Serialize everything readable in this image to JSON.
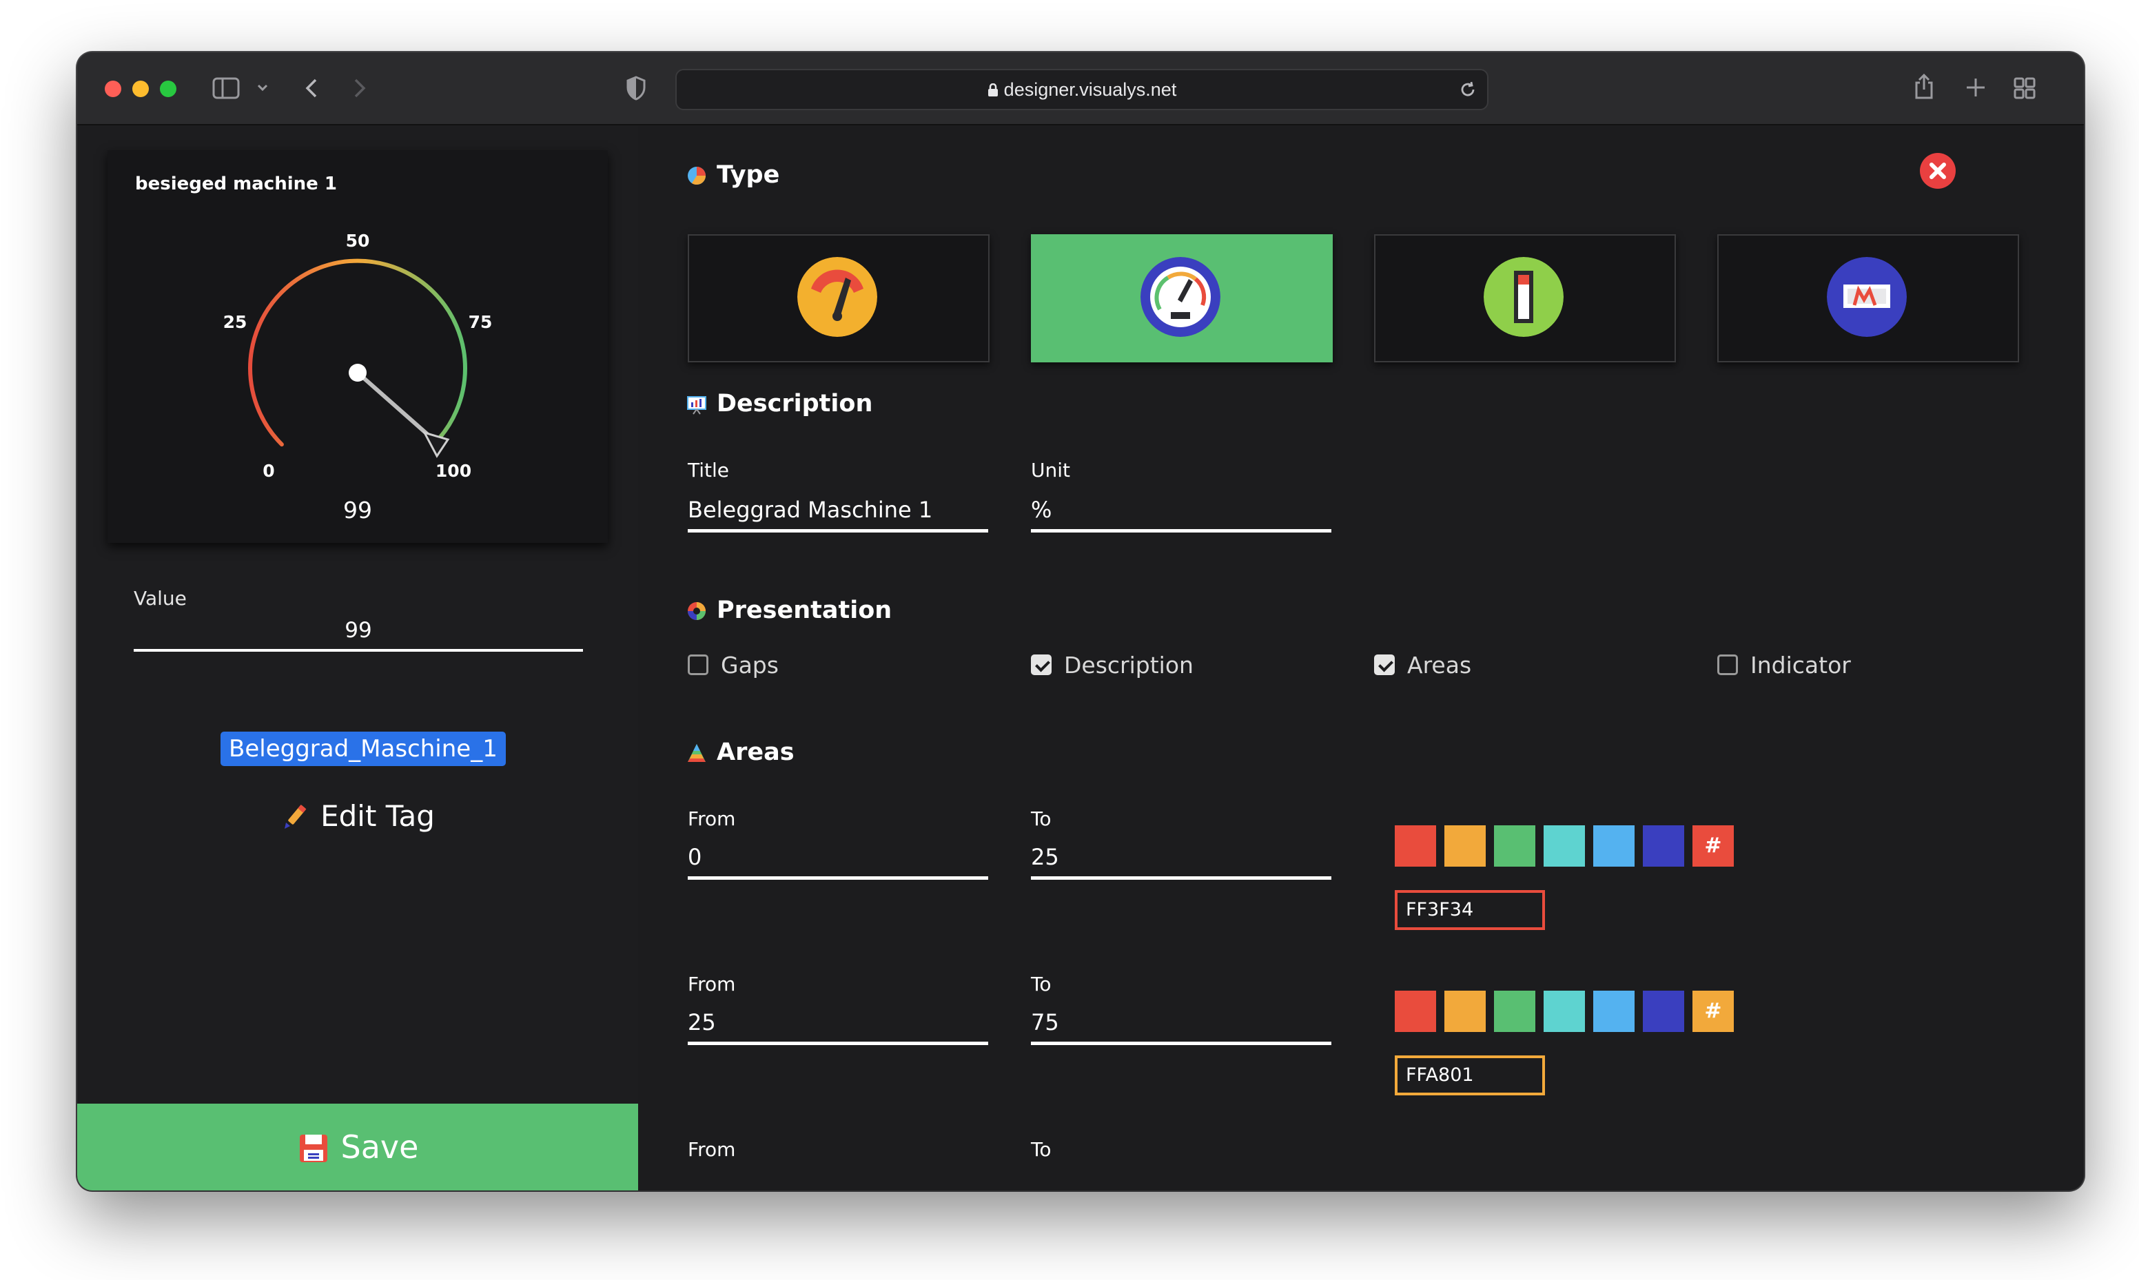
{
  "browser": {
    "url": "designer.visualys.net"
  },
  "gauge_card": {
    "title": "besieged machine 1",
    "ticks": [
      "0",
      "25",
      "50",
      "75",
      "100"
    ],
    "value": "99",
    "colors": {
      "low": "#E54C3C",
      "mid": "#F4A93A",
      "high": "#5CC06E"
    }
  },
  "value_input": {
    "label": "Value",
    "value": "99"
  },
  "tag": {
    "name": "Beleggrad_Maschine_1",
    "edit_label": "Edit Tag"
  },
  "save_button": {
    "label": "Save",
    "color": "#59BF72"
  },
  "type_section": {
    "title": "Type",
    "options": [
      {
        "icon": "semi-gauge-icon",
        "active": false
      },
      {
        "icon": "round-gauge-icon",
        "active": true
      },
      {
        "icon": "bar-indicator-icon",
        "active": false
      },
      {
        "icon": "display-panel-icon",
        "active": false
      }
    ]
  },
  "description_section": {
    "title": "Description",
    "title_field": {
      "label": "Title",
      "value": "Beleggrad Maschine 1"
    },
    "unit_field": {
      "label": "Unit",
      "value": "%"
    }
  },
  "presentation_section": {
    "title": "Presentation",
    "options": [
      {
        "label": "Gaps",
        "checked": false
      },
      {
        "label": "Description",
        "checked": true
      },
      {
        "label": "Areas",
        "checked": true
      },
      {
        "label": "Indicator",
        "checked": false
      }
    ]
  },
  "areas_section": {
    "title": "Areas",
    "palette": [
      "#E94C3D",
      "#F2A93B",
      "#59BF72",
      "#5ED3D0",
      "#54B2F0",
      "#3A3FBF"
    ],
    "areas": [
      {
        "from_label": "From",
        "from": "0",
        "to_label": "To",
        "to": "25",
        "hex": "FF3F34",
        "color": "#E94C3D"
      },
      {
        "from_label": "From",
        "from": "25",
        "to_label": "To",
        "to": "75",
        "hex": "FFA801",
        "color": "#F2A93B"
      },
      {
        "from_label": "From",
        "to_label": "To"
      }
    ]
  }
}
